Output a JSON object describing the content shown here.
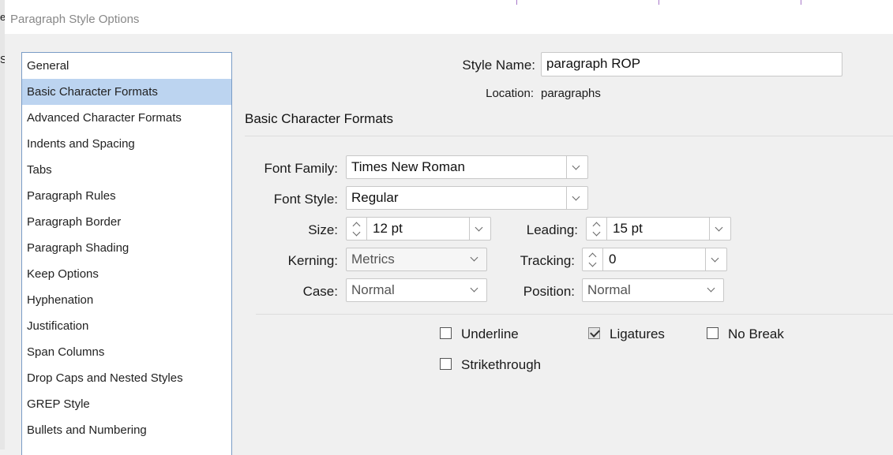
{
  "window": {
    "title": "Paragraph Style Options"
  },
  "sidebar": {
    "items": [
      {
        "label": "General",
        "selected": false
      },
      {
        "label": "Basic Character Formats",
        "selected": true
      },
      {
        "label": "Advanced Character Formats",
        "selected": false
      },
      {
        "label": "Indents and Spacing",
        "selected": false
      },
      {
        "label": "Tabs",
        "selected": false
      },
      {
        "label": "Paragraph Rules",
        "selected": false
      },
      {
        "label": "Paragraph Border",
        "selected": false
      },
      {
        "label": "Paragraph Shading",
        "selected": false
      },
      {
        "label": "Keep Options",
        "selected": false
      },
      {
        "label": "Hyphenation",
        "selected": false
      },
      {
        "label": "Justification",
        "selected": false
      },
      {
        "label": "Span Columns",
        "selected": false
      },
      {
        "label": "Drop Caps and Nested Styles",
        "selected": false
      },
      {
        "label": "GREP Style",
        "selected": false
      },
      {
        "label": "Bullets and Numbering",
        "selected": false
      }
    ]
  },
  "header": {
    "style_name_label": "Style Name:",
    "style_name_value": "paragraph ROP",
    "location_label": "Location:",
    "location_value": "paragraphs"
  },
  "section": {
    "title": "Basic Character Formats"
  },
  "fields": {
    "font_family": {
      "label": "Font Family:",
      "value": "Times New Roman"
    },
    "font_style": {
      "label": "Font Style:",
      "value": "Regular"
    },
    "size": {
      "label": "Size:",
      "value": "12 pt"
    },
    "leading": {
      "label": "Leading:",
      "value": "15 pt"
    },
    "kerning": {
      "label": "Kerning:",
      "value": "Metrics"
    },
    "tracking": {
      "label": "Tracking:",
      "value": "0"
    },
    "case": {
      "label": "Case:",
      "value": "Normal"
    },
    "position": {
      "label": "Position:",
      "value": "Normal"
    }
  },
  "checkboxes": {
    "underline": {
      "label": "Underline",
      "checked": false
    },
    "ligatures": {
      "label": "Ligatures",
      "checked": true
    },
    "no_break": {
      "label": "No Break",
      "checked": false
    },
    "strikethrough": {
      "label": "Strikethrough",
      "checked": false
    }
  },
  "background": {
    "edge_chars": [
      "e",
      "S"
    ]
  },
  "colors": {
    "selection": "#bcd4f0",
    "sidebar_border": "#7a9cc6"
  }
}
